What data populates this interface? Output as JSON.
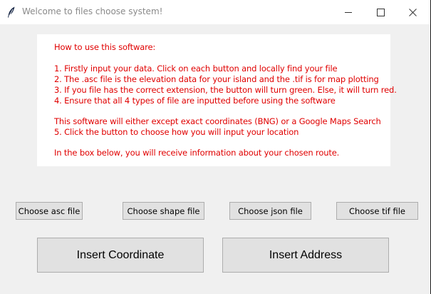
{
  "window": {
    "title": "Welcome to files choose system!"
  },
  "instructions": [
    "How to use this software:",
    "1. Firstly input your data. Click on each button and locally find your file",
    "2. The .asc file is the elevation data for your island and the .tif is for map plotting",
    "3. If you file has the correct extension, the button will turn green. Else, it will turn red.",
    "4. Ensure that all 4 types of file are inputted before using the software",
    "This software will either except exact coordinates (BNG) or a Google Maps Search",
    "5. Click the button to choose how you will input your location",
    "In the box below, you will receive information about your chosen route."
  ],
  "file_buttons": [
    "Choose asc file",
    "Choose shape file",
    "Choose json file",
    "Choose tif file"
  ],
  "mode_buttons": [
    "Insert Coordinate",
    "Insert Address"
  ],
  "colors": {
    "instruction_text": "#e00000",
    "window_bg": "#f0f0f0",
    "button_bg": "#e1e1e1"
  },
  "icons": {
    "app": "feather-icon",
    "minimize": "minimize-icon",
    "maximize": "maximize-icon",
    "close": "close-icon"
  }
}
